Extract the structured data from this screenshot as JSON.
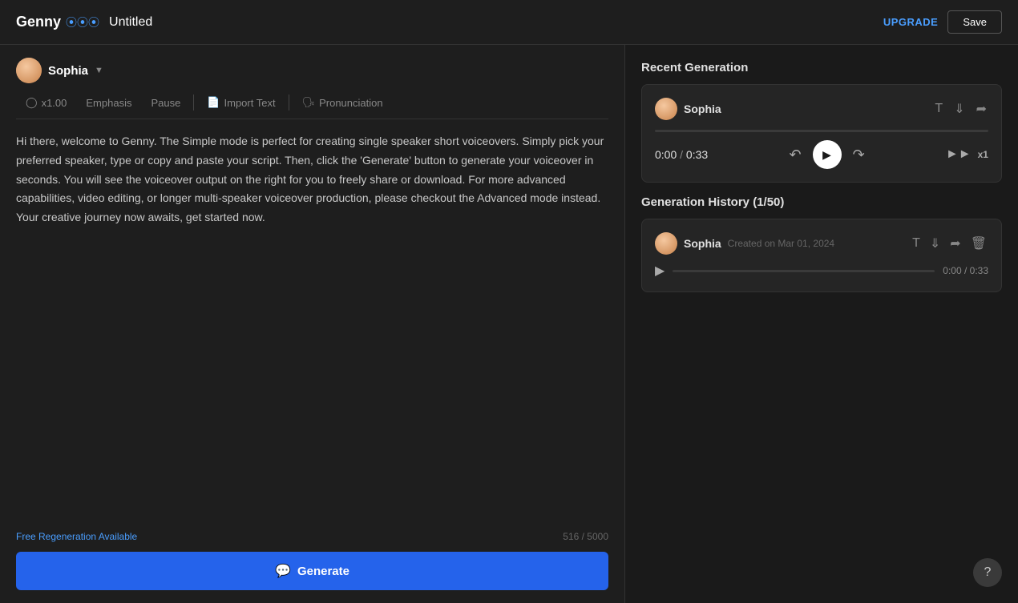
{
  "header": {
    "logo_text": "Genny",
    "logo_wave": "∿",
    "doc_title": "Untitled",
    "upgrade_label": "UPGRADE",
    "save_label": "Save"
  },
  "left_panel": {
    "speaker": {
      "name": "Sophia"
    },
    "toolbar": {
      "speed_label": "x1.00",
      "emphasis_label": "Emphasis",
      "pause_label": "Pause",
      "import_text_label": "Import Text",
      "pronunciation_label": "Pronunciation"
    },
    "main_text": "Hi there, welcome to Genny. The Simple mode is perfect for creating single speaker short voiceovers. Simply pick your preferred speaker, type or copy and paste your script. Then, click the 'Generate' button to generate your voiceover in seconds. You will see the voiceover output on the right for you to freely share or download. For more advanced capabilities, video editing, or longer multi-speaker voiceover production, please checkout the Advanced mode instead. Your creative journey now awaits, get started now.",
    "footer": {
      "free_regen": "Free Regeneration Available",
      "char_count": "516 / 5000"
    },
    "generate_btn_label": "Generate"
  },
  "right_panel": {
    "recent_title": "Recent Generation",
    "recent_card": {
      "speaker_name": "Sophia",
      "time_current": "0:00",
      "time_total": "0:33",
      "speed": "x1"
    },
    "history_title": "Generation History (1/50)",
    "history_card": {
      "speaker_name": "Sophia",
      "created_date": "Created on Mar 01, 2024",
      "time_current": "0:00",
      "time_total": "0:33"
    }
  },
  "help_btn_label": "?"
}
